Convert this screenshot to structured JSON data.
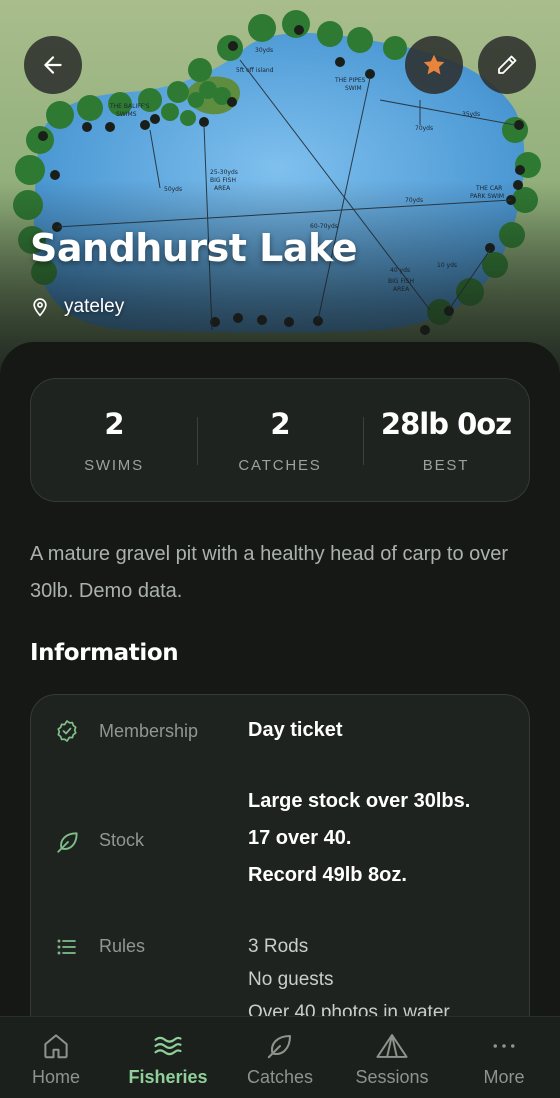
{
  "hero": {
    "title": "Sandhurst Lake",
    "location": "yateley",
    "map_labels": {
      "bailiffs_swim": "THE BALIFF'S SWIMS",
      "pipes_swim": "THE PIPES SWIM",
      "car_park_swim": "THE CAR PARK SWIM",
      "big_fish_area_1": "BIG FISH AREA",
      "big_fish_area_2": "BIG FISH AREA",
      "island": "5ft off island",
      "yds_30": "30yds",
      "yds_50": "50yds",
      "yds_70": "70yds",
      "yds_35": "35yds",
      "yds_25_30": "25-30yds",
      "yds_60_70": "60-70yds",
      "yds_40": "40 yds",
      "yds_10": "10 yds"
    }
  },
  "buttons": {
    "back": "back",
    "favourite": "favourite",
    "edit": "edit"
  },
  "stats": [
    {
      "value": "2",
      "label": "SWIMS"
    },
    {
      "value": "2",
      "label": "CATCHES"
    },
    {
      "value": "28lb 0oz",
      "label": "BEST"
    }
  ],
  "description": "A mature gravel pit with a healthy head of carp to over 30lb. Demo data.",
  "information": {
    "heading": "Information",
    "membership": {
      "key": "Membership",
      "value": "Day ticket"
    },
    "stock": {
      "key": "Stock",
      "lines": [
        "Large stock over 30lbs.",
        "17 over 40.",
        "Record 49lb 8oz."
      ]
    },
    "rules": {
      "key": "Rules",
      "lines": [
        "3 Rods",
        "No guests",
        "Over 40 photos in water"
      ]
    }
  },
  "nav": [
    {
      "label": "Home",
      "icon": "home-icon",
      "active": false
    },
    {
      "label": "Fisheries",
      "icon": "waves-icon",
      "active": true
    },
    {
      "label": "Catches",
      "icon": "leaf-icon",
      "active": false
    },
    {
      "label": "Sessions",
      "icon": "tent-icon",
      "active": false
    },
    {
      "label": "More",
      "icon": "more-icon",
      "active": false
    }
  ],
  "colors": {
    "accent": "#8fcf9a",
    "favourite": "#e8843c",
    "water": "#4f9bd6",
    "background": "#161816"
  }
}
